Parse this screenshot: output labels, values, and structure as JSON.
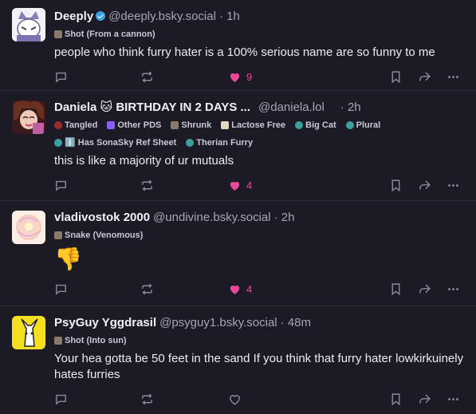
{
  "posts": [
    {
      "name": "Deeply",
      "verified": true,
      "handle": "@deeply.bsky.social",
      "time": "· 1h",
      "labels": [
        {
          "text": "Shot (From a cannon)",
          "color": "#8a7a6a"
        }
      ],
      "text": "people who think furry hater is a 100% serious name are so funny to me",
      "likes": "9",
      "liked": true
    },
    {
      "name": "Daniela 🐱 BIRTHDAY IN 2 DAYS ...",
      "verified": false,
      "handle": "@daniela.lol",
      "time": "· 2h",
      "labels": [
        {
          "text": "Tangled",
          "color": "#9b2c2c"
        },
        {
          "text": "Other PDS",
          "color": "#8b5cf6"
        },
        {
          "text": "Shrunk",
          "color": "#8a7a6a"
        },
        {
          "text": "Lactose Free",
          "color": "#e5d6c2"
        },
        {
          "text": "Big Cat",
          "color": "#3aa0a0"
        },
        {
          "text": "Plural",
          "color": "#3aa0a0"
        },
        {
          "text": "ℹ️ Has SonaSky Ref Sheet",
          "color": "#3aa0a0"
        },
        {
          "text": "Therian Furry",
          "color": "#3aa0a0"
        }
      ],
      "text": "this is like a majority of ur mutuals",
      "likes": "4",
      "liked": true
    },
    {
      "name": "vladivostok 2000",
      "verified": false,
      "handle": "@undivine.bsky.social",
      "time": "· 2h",
      "labels": [
        {
          "text": "Snake (Venomous)",
          "color": "#8a7a6a"
        }
      ],
      "text": "👎",
      "likes": "4",
      "liked": true
    },
    {
      "name": "PsyGuy Yggdrasil",
      "verified": false,
      "handle": "@psyguy1.bsky.social",
      "time": "· 48m",
      "labels": [
        {
          "text": "Shot (Into sun)",
          "color": "#8a7a6a"
        }
      ],
      "text": "Your hea gotta be 50 feet in the sand If you think that furry hater lowkirkuinely hates furries",
      "likes": "",
      "liked": false
    }
  ],
  "colors": {
    "like": "#ec4899",
    "muted": "#8d89a0",
    "background": "#1c1a24"
  }
}
